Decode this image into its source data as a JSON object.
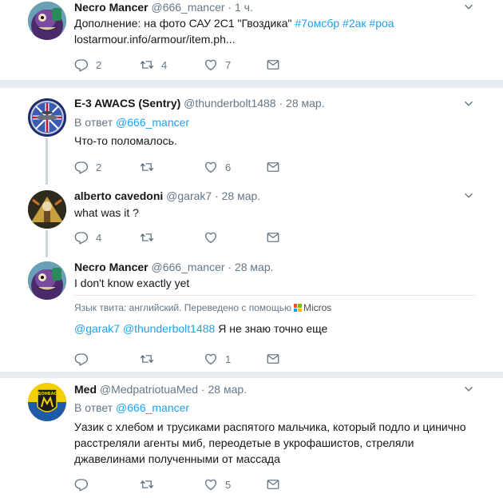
{
  "tweets": [
    {
      "name": "Necro Mancer",
      "handle": "@666_mancer",
      "time": "· 1 ч.",
      "text_prefix": "Дополнение: на фото САУ 2С1 \"Гвоздика\" ",
      "hashtags": "#7омсбр #2ак #роа",
      "link": "lostarmour.info/armour/item.ph...",
      "replies": "2",
      "retweets": "4",
      "likes": "7"
    },
    {
      "name": "E-3 AWACS (Sentry)",
      "handle": "@thunderbolt1488",
      "time": "· 28 мар.",
      "reply_label": "В ответ",
      "reply_mention": "@666_mancer",
      "text": "Что-то поломалось.",
      "replies": "2",
      "retweets": "",
      "likes": "6"
    },
    {
      "name": "alberto cavedoni",
      "handle": "@garak7",
      "time": "· 28 мар.",
      "text": "what was it ?",
      "replies": "4",
      "retweets": "",
      "likes": ""
    },
    {
      "name": "Necro Mancer",
      "handle": "@666_mancer",
      "time": "· 28 мар.",
      "text": "I don't know exactly yet",
      "translation_label": "Язык твита: английский. Переведено с помощью",
      "translation_brand": "Micros",
      "translation_mentions": "@garak7 @thunderbolt1488",
      "translation_text": " Я не знаю точно еще",
      "replies": "",
      "retweets": "",
      "likes": "1"
    },
    {
      "name": "Med",
      "handle": "@MedpatriotuaMed",
      "time": "· 28 мар.",
      "reply_label": "В ответ",
      "reply_mention": "@666_mancer",
      "text_line1": "Уазик с хлебом и трусиками распятого мальчика, который подло и цинично",
      "text_line2": "расстреляли агенты миб, переодетые в укрофашистов, стреляли",
      "text_line3": "джавелинами полученными от массада",
      "replies": "",
      "retweets": "",
      "likes": "5"
    }
  ],
  "avatar_labels": {
    "med": "ДОНБАС"
  },
  "colors": {
    "link": "#1da1f2",
    "muted": "#657786",
    "divider": "#e6ecf0",
    "thread_line": "#ccd6dd"
  }
}
